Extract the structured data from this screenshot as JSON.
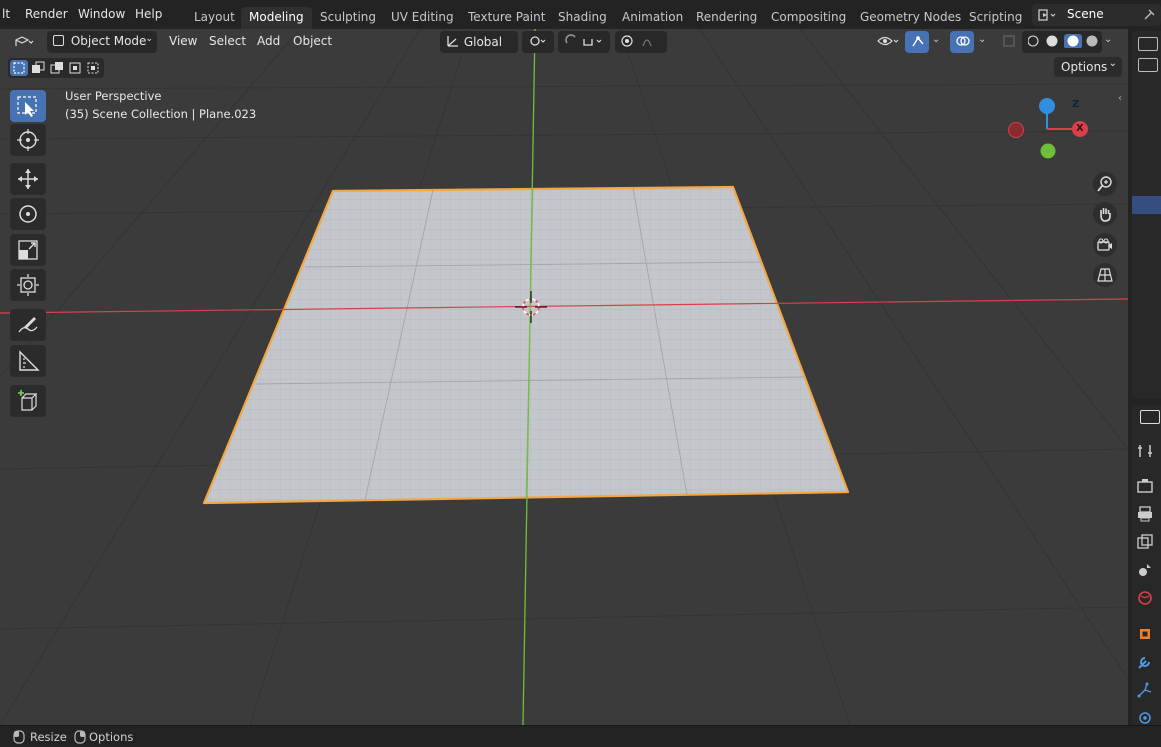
{
  "menu": {
    "items": [
      "lt",
      "Render",
      "Window",
      "Help"
    ]
  },
  "workspaces": [
    "Layout",
    "Modeling",
    "Sculpting",
    "UV Editing",
    "Texture Paint",
    "Shading",
    "Animation",
    "Rendering",
    "Compositing",
    "Geometry Nodes",
    "Scripting"
  ],
  "active_workspace": "Modeling",
  "scene": {
    "name": "Scene"
  },
  "viewport_header": {
    "mode": "Object Mode",
    "menus": [
      "View",
      "Select",
      "Add",
      "Object"
    ],
    "orientation": "Global",
    "options_label": "Options"
  },
  "overlay": {
    "perspective": "User Perspective",
    "collection_info": "(35) Scene Collection | Plane.023"
  },
  "gizmo": {
    "z": "Z",
    "x": "X"
  },
  "status_bar": {
    "resize": "Resize",
    "options": "Options"
  },
  "colors": {
    "selection_outline": "#f5a742",
    "x_axis": "#d9404a",
    "y_axis": "#6fbf3a",
    "z_axis": "#2f8fe0",
    "accent": "#4772b3"
  }
}
